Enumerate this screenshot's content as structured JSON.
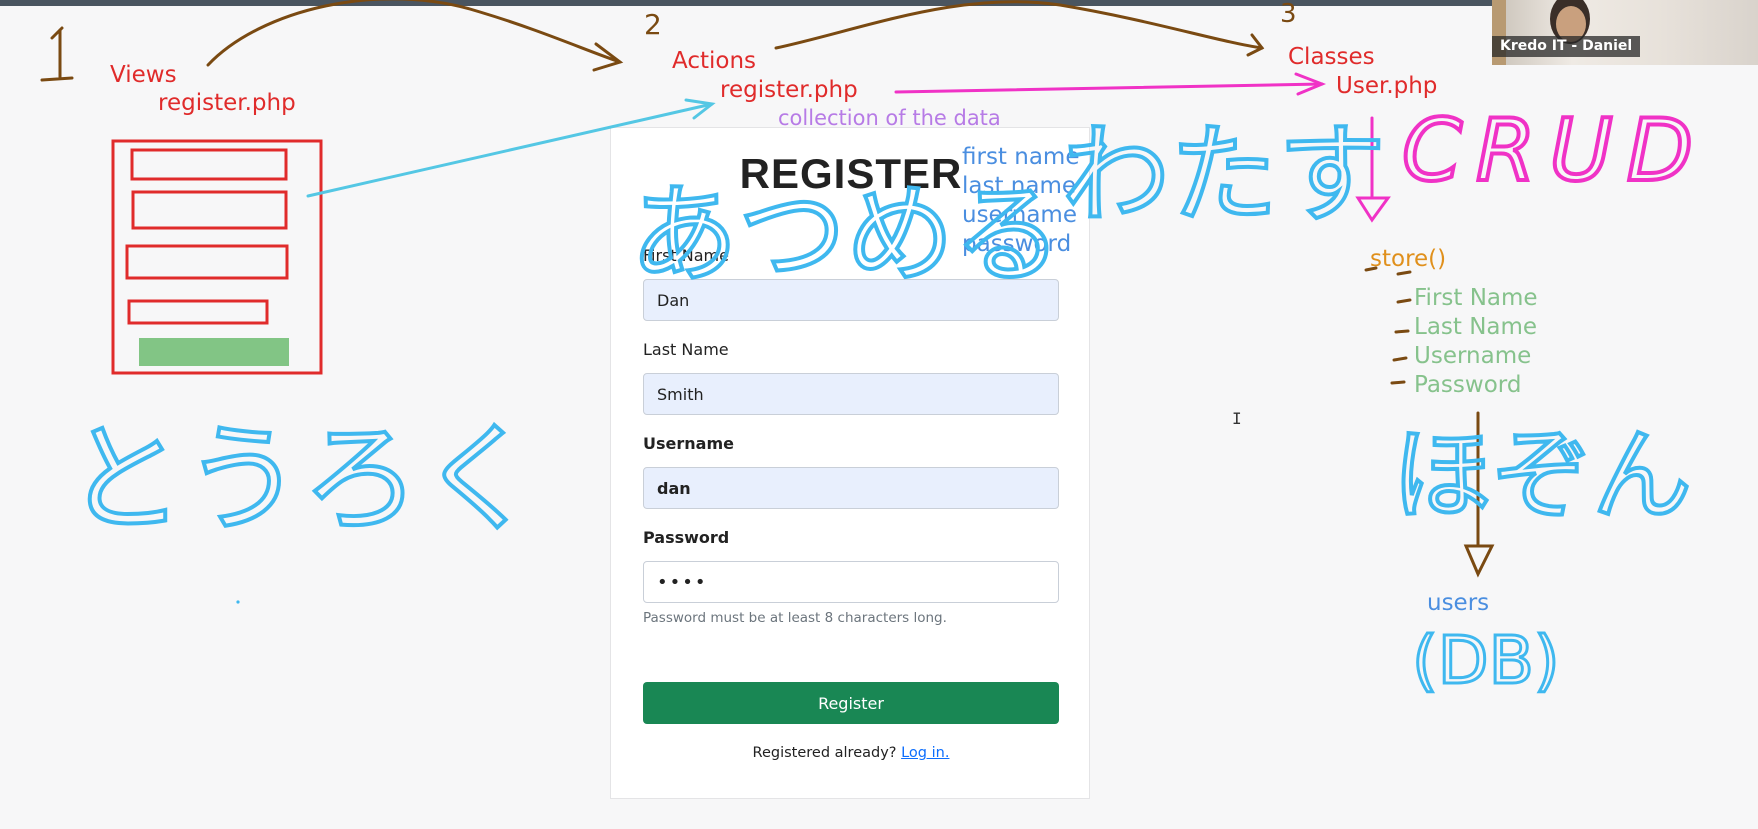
{
  "annotations": {
    "num1": "1",
    "num2": "2",
    "num3": "3",
    "views": "Views",
    "views_file": "register.php",
    "actions": "Actions",
    "actions_file": "register.php",
    "collection": "collection of the data",
    "classes": "Classes",
    "classes_file": "User.php",
    "fields": [
      "first name",
      "last name",
      "username",
      "password"
    ],
    "store": "store()",
    "store_fields": [
      "First Name",
      "Last Name",
      "Username",
      "Password"
    ],
    "users": "users",
    "db": "(DB)",
    "crud": "CRUD",
    "jp_touroku": "とうろく",
    "jp_atsumeru": "あつめる",
    "jp_watasu": "わたす",
    "jp_hozon": "ほぞん"
  },
  "form": {
    "title": "REGISTER",
    "first_name": {
      "label": "First Name",
      "value": "Dan"
    },
    "last_name": {
      "label": "Last Name",
      "value": "Smith"
    },
    "username": {
      "label": "Username",
      "value": "dan"
    },
    "password": {
      "label": "Password",
      "value": "••••",
      "help": "Password must be at least 8 characters long."
    },
    "submit_label": "Register",
    "login_prompt": "Registered already?",
    "login_link": "Log in."
  },
  "webcam": {
    "label": "Kredo IT - Daniel"
  },
  "colors": {
    "red": "#e02b2b",
    "brown": "#7a4a12",
    "cyan": "#3fb8ef",
    "magenta": "#f032c6",
    "purple": "#b77be6",
    "blue": "#4a8ee0",
    "orange": "#e0901c",
    "green_text": "#86c28c",
    "green_button": "#198754"
  }
}
